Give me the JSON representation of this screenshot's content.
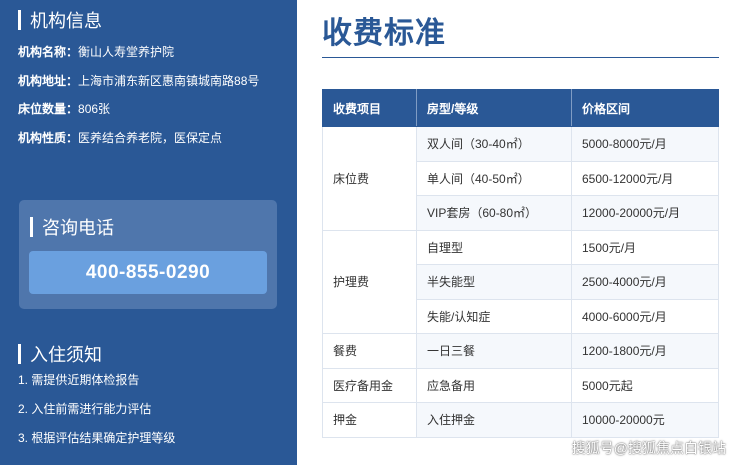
{
  "sidebar": {
    "org_info": {
      "heading": "机构信息",
      "rows": [
        {
          "label": "机构名称：",
          "value": "衡山人寿堂养护院"
        },
        {
          "label": "机构地址：",
          "value": "上海市浦东新区惠南镇城南路88号"
        },
        {
          "label": "床位数量：",
          "value": "806张"
        },
        {
          "label": "机构性质：",
          "value": "医养结合养老院，医保定点"
        }
      ]
    },
    "consult": {
      "heading": "咨询电话",
      "phone": "400-855-0290"
    },
    "notes": {
      "heading": "入住须知",
      "items": [
        "1. 需提供近期体检报告",
        "2. 入住前需进行能力评估",
        "3. 根据评估结果确定护理等级"
      ]
    }
  },
  "main": {
    "title": "收费标准",
    "table": {
      "headers": [
        "收费项目",
        "房型/等级",
        "价格区间"
      ],
      "groups": [
        {
          "category": "床位费",
          "rows": [
            {
              "type": "双人间（30-40㎡）",
              "price": "5000-8000元/月"
            },
            {
              "type": "单人间（40-50㎡）",
              "price": "6500-12000元/月"
            },
            {
              "type": "VIP套房（60-80㎡）",
              "price": "12000-20000元/月"
            }
          ]
        },
        {
          "category": "护理费",
          "rows": [
            {
              "type": "自理型",
              "price": "1500元/月"
            },
            {
              "type": "半失能型",
              "price": "2500-4000元/月"
            },
            {
              "type": "失能/认知症",
              "price": "4000-6000元/月"
            }
          ]
        },
        {
          "category": "餐费",
          "rows": [
            {
              "type": "一日三餐",
              "price": "1200-1800元/月"
            }
          ]
        },
        {
          "category": "医疗备用金",
          "rows": [
            {
              "type": "应急备用",
              "price": "5000元起"
            }
          ]
        },
        {
          "category": "押金",
          "rows": [
            {
              "type": "入住押金",
              "price": "10000-20000元"
            }
          ]
        }
      ]
    }
  },
  "watermark": "搜狐号@搜狐焦点白银站"
}
